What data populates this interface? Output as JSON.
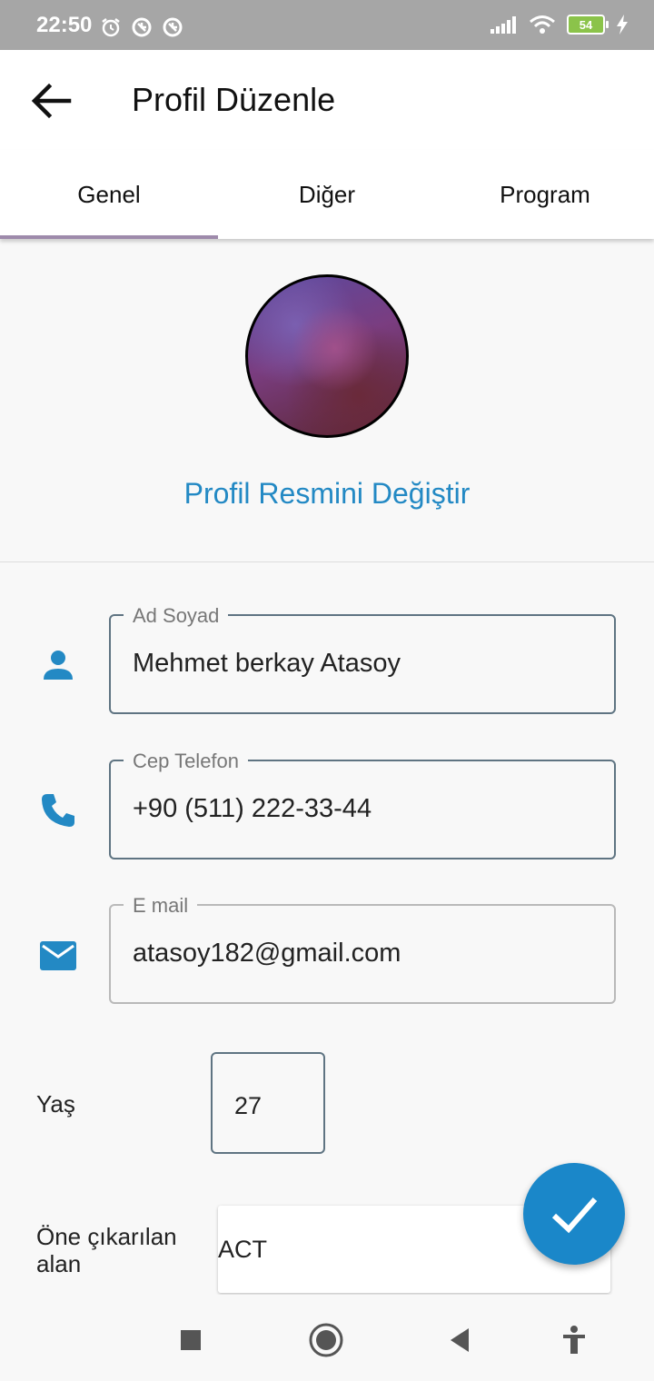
{
  "status_bar": {
    "time": "22:50",
    "battery": "54",
    "icons_left": [
      "alarm-icon",
      "data-saver-icon",
      "data-saver-icon"
    ],
    "icons_right": [
      "signal-icon",
      "wifi-icon",
      "battery-icon",
      "charging-icon"
    ]
  },
  "app_bar": {
    "title": "Profil Düzenle",
    "back_icon": "arrow-back-icon"
  },
  "tabs": [
    {
      "label": "Genel",
      "active": true
    },
    {
      "label": "Diğer",
      "active": false
    },
    {
      "label": "Program",
      "active": false
    }
  ],
  "profile": {
    "change_photo_label": "Profil Resmini Değiştir"
  },
  "fields": {
    "name": {
      "label": "Ad Soyad",
      "value": "Mehmet berkay Atasoy",
      "icon": "person-icon"
    },
    "phone": {
      "label": "Cep Telefon",
      "value": "+90 (511) 222-33-44",
      "icon": "phone-icon"
    },
    "email": {
      "label": "E mail",
      "value": "atasoy182@gmail.com",
      "icon": "email-icon"
    },
    "age": {
      "label": "Yaş",
      "value": "27"
    },
    "featured": {
      "label": "Öne çıkarılan alan",
      "value": "ACT"
    }
  },
  "fab": {
    "icon": "check-icon"
  },
  "nav_bar": {
    "icons": [
      "recents-square-icon",
      "home-circle-icon",
      "back-triangle-icon",
      "accessibility-icon"
    ]
  },
  "colors": {
    "accent": "#2389c4",
    "fab": "#1a87c9",
    "tab_indicator": "#9e8aab",
    "status_bar": "#a6a6a6"
  }
}
